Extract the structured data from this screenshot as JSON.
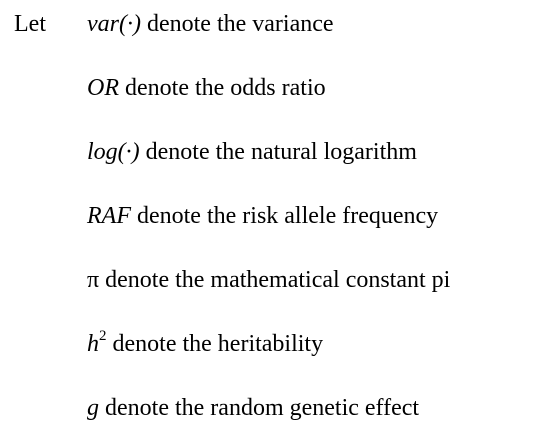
{
  "intro": "Let",
  "definitions": [
    {
      "symbol": "var(·)",
      "text": " denote the variance"
    },
    {
      "symbol": "OR",
      "text": " denote the odds ratio"
    },
    {
      "symbol": "log(·)",
      "text": " denote the natural logarithm"
    },
    {
      "symbol": "RAF",
      "text": " denote the risk allele frequency"
    },
    {
      "symbol": "π",
      "text": " denote the mathematical constant pi"
    },
    {
      "symbol": "h",
      "superscript": "2",
      "text": " denote the heritability"
    },
    {
      "symbol": "g",
      "text": " denote the random genetic effect"
    }
  ]
}
